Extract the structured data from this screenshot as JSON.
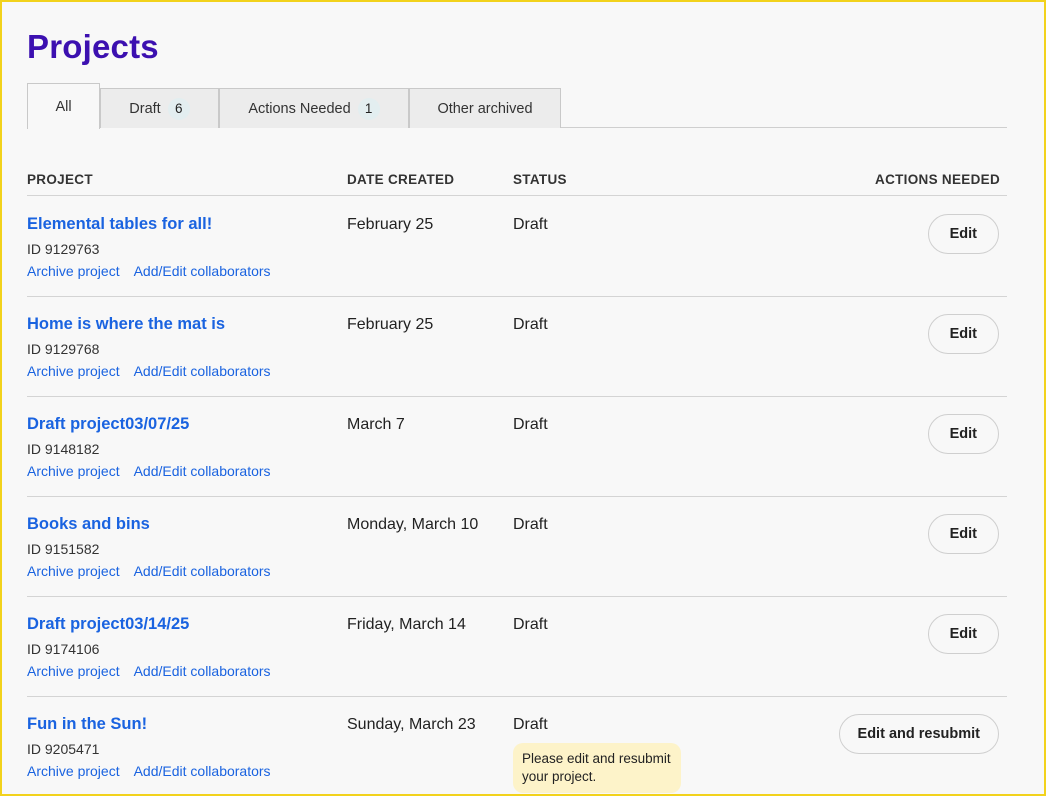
{
  "page": {
    "title": "Projects"
  },
  "tabs": [
    {
      "label": "All",
      "count": null
    },
    {
      "label": "Draft",
      "count": "6"
    },
    {
      "label": "Actions Needed",
      "count": "1"
    },
    {
      "label": "Other archived",
      "count": null
    }
  ],
  "columns": {
    "project": "PROJECT",
    "date_created": "DATE CREATED",
    "status": "STATUS",
    "actions_needed": "ACTIONS NEEDED"
  },
  "rows": [
    {
      "title": "Elemental tables for all!",
      "id": "ID 9129763",
      "archive": "Archive project",
      "collab": "Add/Edit collaborators",
      "date": "February 25",
      "status": "Draft",
      "action": "Edit"
    },
    {
      "title": "Home is where the mat is",
      "id": "ID 9129768",
      "archive": "Archive project",
      "collab": "Add/Edit collaborators",
      "date": "February 25",
      "status": "Draft",
      "action": "Edit"
    },
    {
      "title": "Draft project03/07/25",
      "id": "ID 9148182",
      "archive": "Archive project",
      "collab": "Add/Edit collaborators",
      "date": "March 7",
      "status": "Draft",
      "action": "Edit"
    },
    {
      "title": "Books and bins",
      "id": "ID 9151582",
      "archive": "Archive project",
      "collab": "Add/Edit collaborators",
      "date": "Monday, March 10",
      "status": "Draft",
      "action": "Edit"
    },
    {
      "title": "Draft project03/14/25",
      "id": "ID 9174106",
      "archive": "Archive project",
      "collab": "Add/Edit collaborators",
      "date": "Friday, March 14",
      "status": "Draft",
      "action": "Edit"
    },
    {
      "title": "Fun in the Sun!",
      "id": "ID 9205471",
      "archive": "Archive project",
      "collab": "Add/Edit collaborators",
      "date": "Sunday, March 23",
      "status": "Draft",
      "action": "Edit and resubmit",
      "note": "Please edit and resubmit your project."
    }
  ]
}
